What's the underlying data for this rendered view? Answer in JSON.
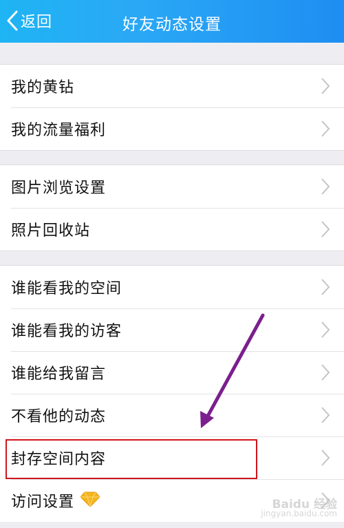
{
  "header": {
    "back_label": "返回",
    "title": "好友动态设置"
  },
  "groups": [
    {
      "items": [
        {
          "label": "我的黄钻"
        },
        {
          "label": "我的流量福利"
        }
      ]
    },
    {
      "items": [
        {
          "label": "图片浏览设置"
        },
        {
          "label": "照片回收站"
        }
      ]
    },
    {
      "items": [
        {
          "label": "谁能看我的空间"
        },
        {
          "label": "谁能看我的访客"
        },
        {
          "label": "谁能给我留言"
        },
        {
          "label": "不看他的动态"
        },
        {
          "label": "封存空间内容"
        },
        {
          "label": "访问设置"
        }
      ]
    }
  ],
  "annotation": {
    "highlighted_item": "封存空间内容",
    "highlight_color": "#d0141c",
    "arrow_color": "#7b1f8e"
  },
  "icons": {
    "back": "chevron-left-icon",
    "row_arrow": "chevron-right-icon",
    "vip": "yellow-diamond-icon"
  },
  "watermark": {
    "brand": "Baidu 经验",
    "url": "jingyan.baidu.com"
  },
  "colors": {
    "header_start": "#1fb4f4",
    "header_end": "#1e8ef2",
    "background": "#eeeef2"
  }
}
